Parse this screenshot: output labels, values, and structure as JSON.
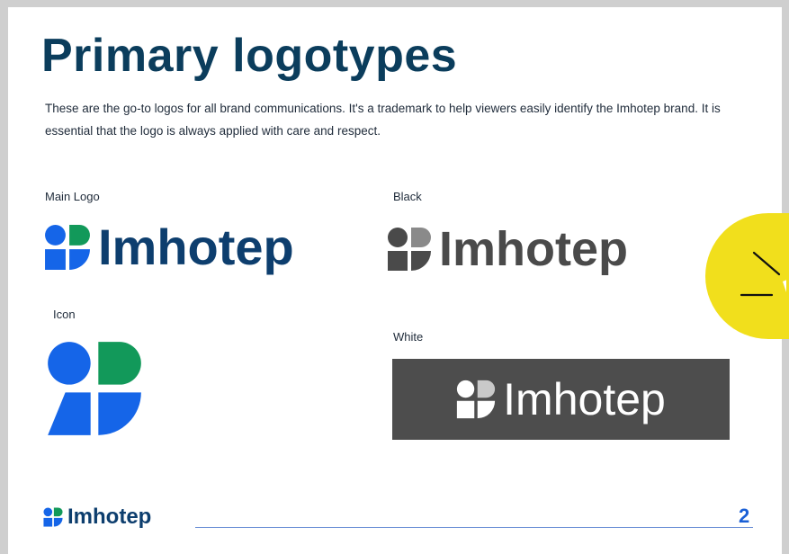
{
  "heading": "Primary logotypes",
  "description": "These are the go-to logos for all brand communications. It's a trademark to help viewers easily identify the Imhotep brand. It is essential that the logo is always applied with care and respect.",
  "sections": {
    "main_logo_label": "Main Logo",
    "black_label": "Black",
    "icon_label": "Icon",
    "white_label": "White"
  },
  "brand": {
    "wordmark": "Imhotep"
  },
  "footer": {
    "wordmark": "Imhotep",
    "page_number": "2"
  },
  "colors": {
    "navy": "#0d3e6e",
    "blue": "#1565e8",
    "green": "#12995a",
    "gray": "#4a4a4a",
    "accent_yellow": "#f1df1c",
    "page_number_blue": "#1a5fd6"
  },
  "icons": [
    "brand-mark-icon",
    "pen-nib-icon"
  ]
}
